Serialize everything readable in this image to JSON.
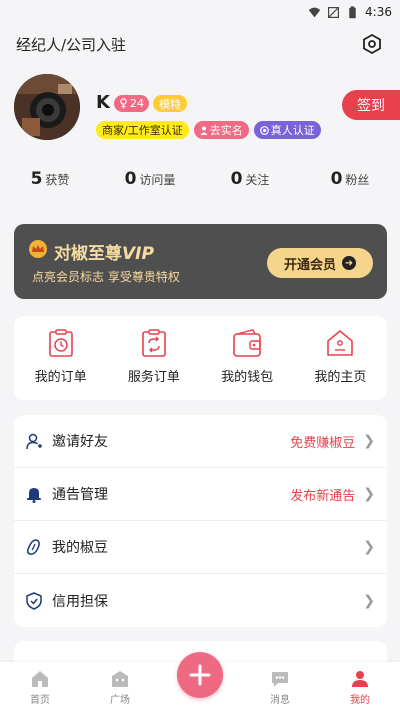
{
  "status_bar": {
    "time": "4:36"
  },
  "header": {
    "title": "经纪人/公司入驻",
    "settings_icon": "hexagon-settings-icon"
  },
  "profile": {
    "name": "K",
    "level": "24",
    "model_badge": "模特",
    "checkin_label": "签到",
    "tags": [
      "商家/工作室认证",
      "去实名",
      "真人认证"
    ]
  },
  "stats": [
    {
      "num": "5",
      "label": "获赞"
    },
    {
      "num": "0",
      "label": "访问量"
    },
    {
      "num": "0",
      "label": "关注"
    },
    {
      "num": "0",
      "label": "粉丝"
    }
  ],
  "vip": {
    "title": "对椒至尊",
    "title_suffix": "VIP",
    "subtitle": "点亮会员标志 享受尊贵特权",
    "button": "开通会员"
  },
  "grid": [
    {
      "label": "我的订单",
      "icon": "order-clock-icon"
    },
    {
      "label": "服务订单",
      "icon": "service-order-icon"
    },
    {
      "label": "我的钱包",
      "icon": "wallet-icon"
    },
    {
      "label": "我的主页",
      "icon": "home-icon"
    }
  ],
  "menu": [
    {
      "label": "邀请好友",
      "extra": "免费赚椒豆",
      "icon": "invite-user-icon"
    },
    {
      "label": "通告管理",
      "extra": "发布新通告",
      "icon": "bell-icon"
    },
    {
      "label": "我的椒豆",
      "extra": "",
      "icon": "pepper-bean-icon"
    },
    {
      "label": "信用担保",
      "extra": "",
      "icon": "shield-check-icon"
    }
  ],
  "tabbar": [
    {
      "label": "首页",
      "icon": "home-tab-icon"
    },
    {
      "label": "广场",
      "icon": "square-tab-icon"
    },
    {
      "label": "消息",
      "icon": "message-tab-icon"
    },
    {
      "label": "我的",
      "icon": "me-tab-icon"
    }
  ],
  "colors": {
    "accent": "#e8404d",
    "fab": "#ee6a82",
    "vip_bg": "#504f50",
    "vip_gold": "#f4d58b"
  }
}
